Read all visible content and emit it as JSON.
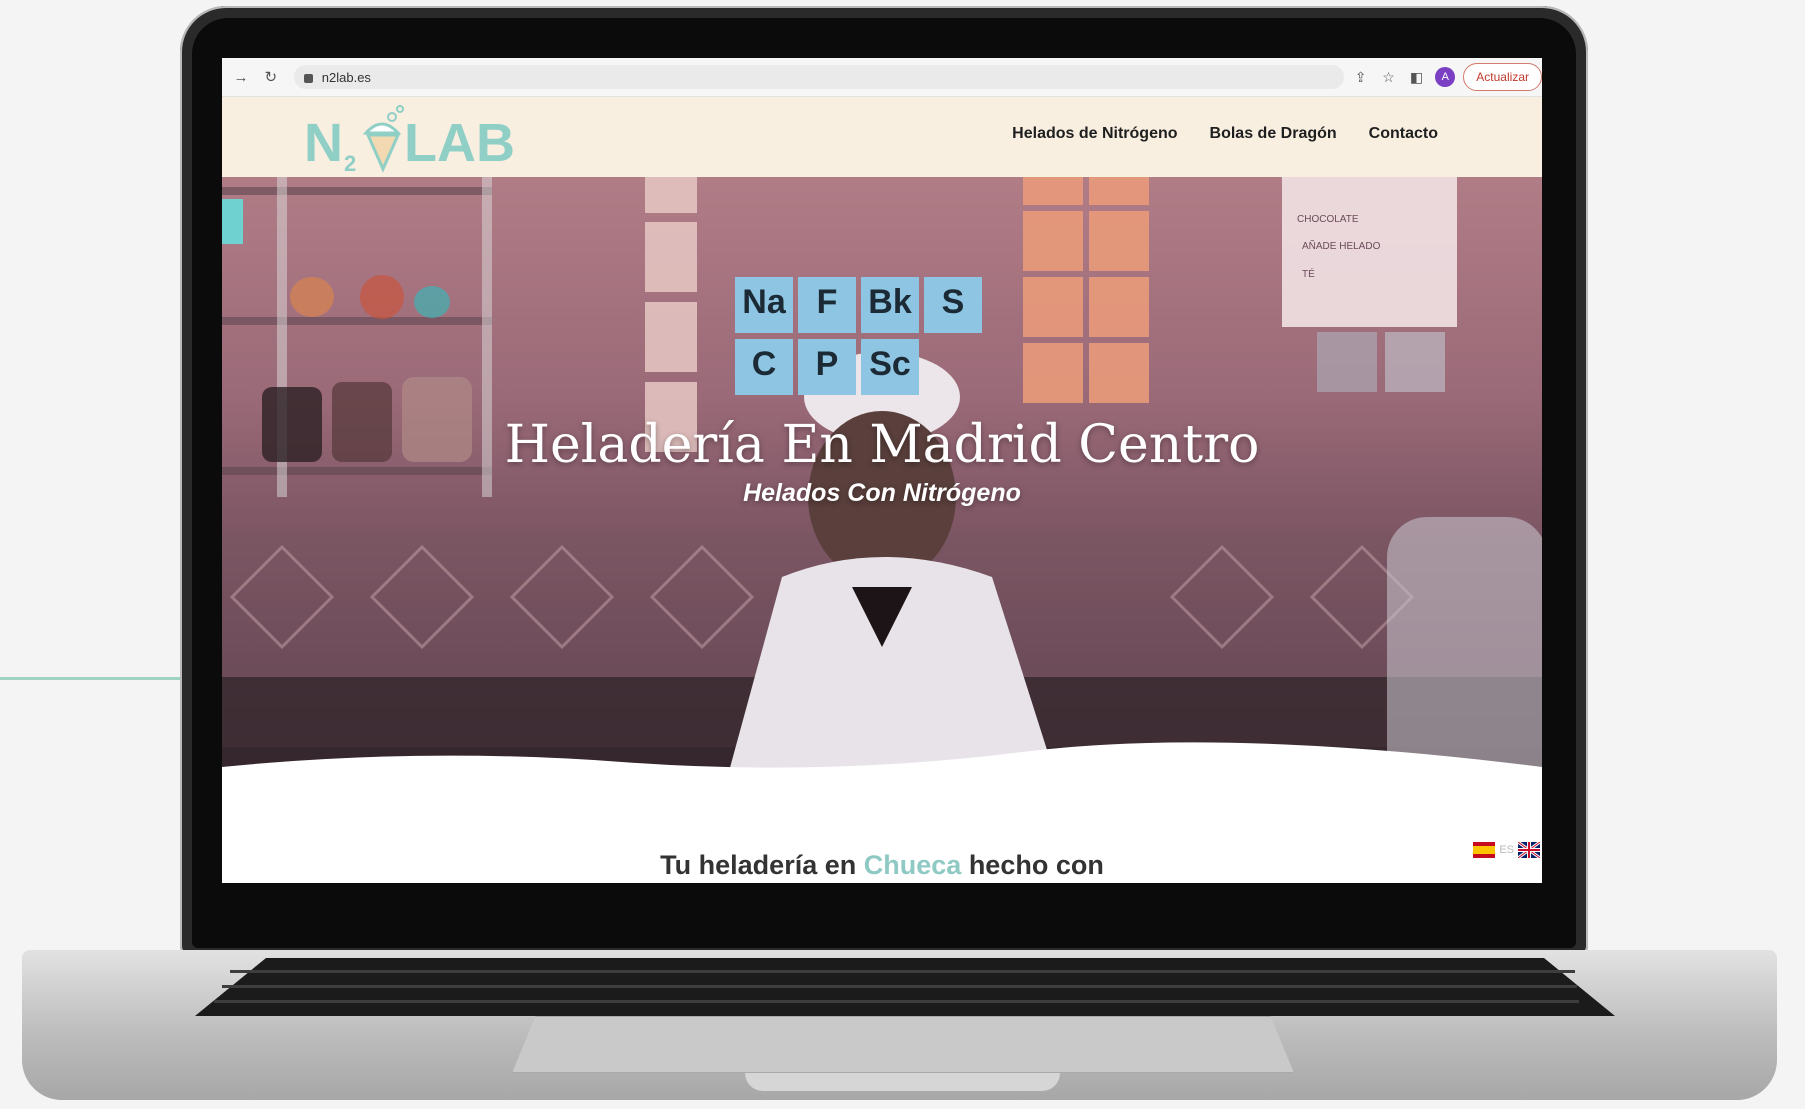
{
  "browser": {
    "url": "n2lab.es",
    "update_button": "Actualizar",
    "profile_initial": "A"
  },
  "site": {
    "logo_alt": "N2LAB",
    "nav": [
      "Helados de Nitrógeno",
      "Bolas de Dragón",
      "Contacto"
    ]
  },
  "hero": {
    "title": "Heladería En Madrid Centro",
    "subtitle": "Helados Con Nitrógeno",
    "elements_row1": [
      "Na",
      "F",
      "Bk",
      "S"
    ],
    "elements_row2": [
      "C",
      "P",
      "Sc"
    ]
  },
  "content": {
    "intro_before": "Tu heladería en",
    "intro_accent": "Chueca",
    "intro_after": "hecho con"
  },
  "languages": [
    "ES",
    "EN"
  ],
  "colors": {
    "header_bg": "#f8efe1",
    "logo": "#8fcfc6",
    "accent": "#8fc9c3",
    "update_btn": "#c0392b"
  }
}
